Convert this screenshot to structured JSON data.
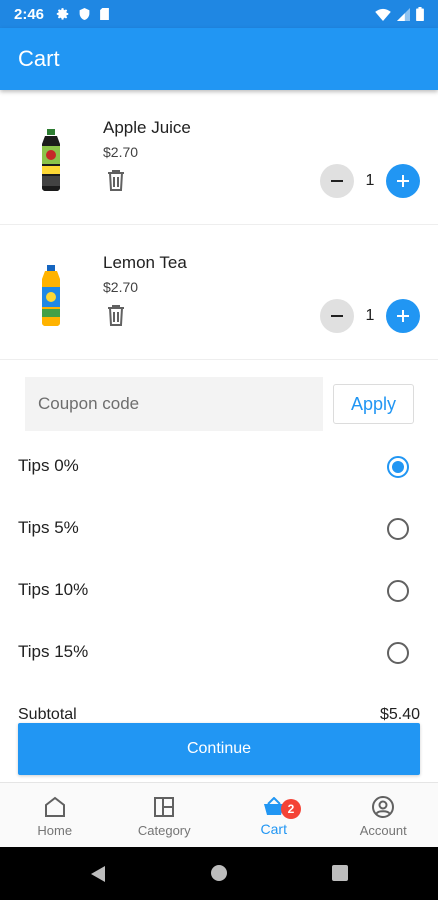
{
  "status_bar": {
    "time": "2:46",
    "icons": [
      "gear-icon",
      "shield-icon",
      "sd-card-icon"
    ],
    "right_icons": [
      "wifi-icon",
      "signal-icon",
      "battery-icon"
    ]
  },
  "app_bar": {
    "title": "Cart"
  },
  "cart_items": [
    {
      "name": "Apple Juice",
      "price": "$2.70",
      "quantity": "1",
      "image": "apple-juice-bottle"
    },
    {
      "name": "Lemon Tea",
      "price": "$2.70",
      "quantity": "1",
      "image": "lemon-tea-bottle"
    }
  ],
  "coupon": {
    "placeholder": "Coupon code",
    "value": "",
    "apply_label": "Apply"
  },
  "tips": [
    {
      "label": "Tips 0%",
      "selected": true
    },
    {
      "label": "Tips 5%",
      "selected": false
    },
    {
      "label": "Tips 10%",
      "selected": false
    },
    {
      "label": "Tips 15%",
      "selected": false
    }
  ],
  "subtotal": {
    "label": "Subtotal",
    "value": "$5.40"
  },
  "continue_label": "Continue",
  "bottom_nav": {
    "items": [
      {
        "label": "Home",
        "icon": "home-icon"
      },
      {
        "label": "Category",
        "icon": "category-icon"
      },
      {
        "label": "Cart",
        "icon": "cart-icon",
        "badge": "2",
        "active": true
      },
      {
        "label": "Account",
        "icon": "account-icon"
      }
    ]
  },
  "colors": {
    "primary": "#2196f3",
    "status_bar": "#1f87e3",
    "badge": "#f44336"
  }
}
